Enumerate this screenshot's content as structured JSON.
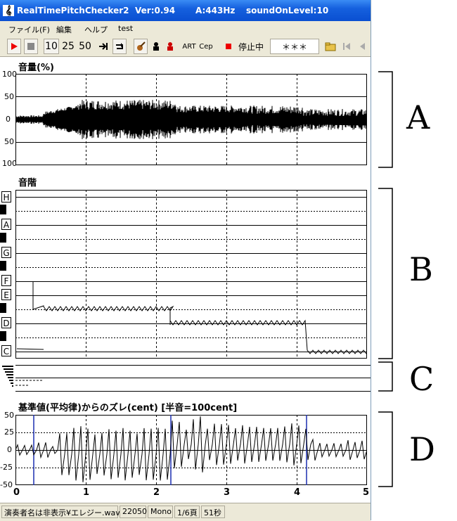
{
  "window": {
    "title": "RealTimePitchChecker2",
    "version": "Ver:0.94",
    "a_freq": "A:443Hz",
    "sound_level": "soundOnLevel:10"
  },
  "menu": [
    "ファイル(F)",
    "編集",
    "ヘルプ",
    "test"
  ],
  "toolbar": {
    "speed_10": "10",
    "speed_25": "25",
    "speed_50": "50",
    "mode_art": "ART",
    "mode_cep": "Cep",
    "status": "停止中",
    "note_display": "＊＊＊"
  },
  "panels": {
    "volume": {
      "title": "音量(%)",
      "ticks": [
        "100",
        "50",
        "0",
        "50",
        "100"
      ]
    },
    "scale": {
      "title": "音階",
      "notes": [
        "H",
        "A",
        "G",
        "F",
        "E",
        "D",
        "C"
      ]
    },
    "deviation": {
      "title": "基準値(平均律)からのズレ(cent) [半音=100cent]",
      "ticks": [
        "50",
        "25",
        "0",
        "-25",
        "-50"
      ]
    },
    "time_ticks": [
      "0",
      "1",
      "2",
      "3",
      "4",
      "5"
    ]
  },
  "annotations": [
    "A",
    "B",
    "C",
    "D"
  ],
  "statusbar": {
    "file": "演奏者名は非表示¥エレジー.wav",
    "rate": "22050",
    "channel": "Mono",
    "page": "1/6頁",
    "duration": "51秒"
  }
}
